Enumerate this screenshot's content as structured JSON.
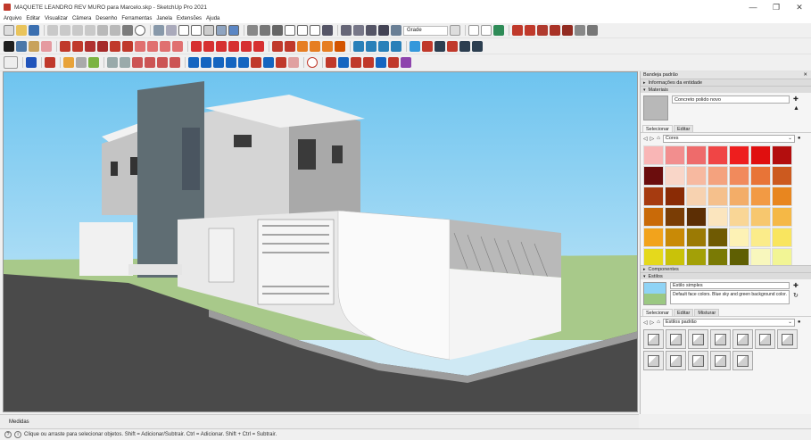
{
  "window": {
    "title": "MAQUETE LEANDRO REV MURO para Marcelo.skp - SketchUp Pro 2021",
    "minimize": "—",
    "maximize": "❐",
    "close": "✕"
  },
  "menu": [
    "Arquivo",
    "Editar",
    "Visualizar",
    "Câmera",
    "Desenho",
    "Ferramentas",
    "Janela",
    "Extensões",
    "Ajuda"
  ],
  "toolbar": {
    "style_select_value": "Grade"
  },
  "tray": {
    "title": "Bandeja padrão",
    "entity_info": "Informações da entidade",
    "materials": {
      "header": "Materiais",
      "current_material": "Concreto polido novo",
      "tabs": [
        "Selecionar",
        "Editar"
      ],
      "library": "Cores",
      "swatch_colors": [
        "#f9b6b6",
        "#f28e8e",
        "#ee6b6b",
        "#f04545",
        "#ee1e1e",
        "#e00f0f",
        "#b30e0e",
        "#6b0d0d",
        "#f9d6c8",
        "#f7b9a0",
        "#f4a27e",
        "#f18a5c",
        "#e87437",
        "#cc5a1f",
        "#a63b10",
        "#8a2b05",
        "#f7d2b0",
        "#f5c08c",
        "#f3ad68",
        "#f29a44",
        "#e8861f",
        "#c96a08",
        "#7a3d05",
        "#5c2e04",
        "#fbe5be",
        "#f9d696",
        "#f7c76e",
        "#f5b846",
        "#f2a31c",
        "#c98a06",
        "#9b7a04",
        "#6f5a03",
        "#fdf2b5",
        "#fbec8a",
        "#f9e55f",
        "#e5d91c",
        "#c9c209",
        "#a3a007",
        "#7a7a05",
        "#5f5f03",
        "#f8f7bd",
        "#f2f595"
      ]
    },
    "components": "Componentes",
    "styles": {
      "header": "Estilos",
      "name": "Estilo simples",
      "description": "Default face colors. Blue sky and green background color.",
      "tabs": [
        "Selecionar",
        "Editar",
        "Misturar"
      ],
      "library": "Estilos padrão"
    }
  },
  "measurements_label": "Medidas",
  "status": {
    "text": "Clique ou arraste para selecionar objetos. Shift = Adicionar/Subtrair. Ctrl = Adicionar. Shift + Ctrl = Subtrair."
  }
}
